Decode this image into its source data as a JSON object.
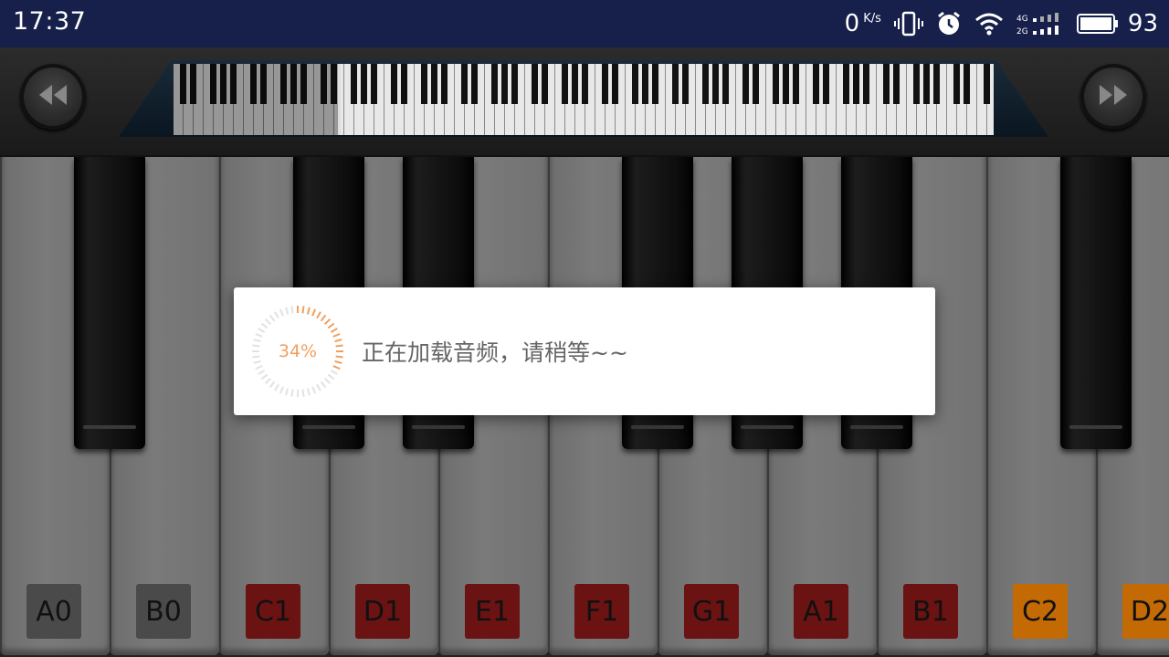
{
  "status_bar": {
    "time": "17:37",
    "net_speed_value": "0",
    "net_speed_unit": "K/s",
    "battery_level": "93",
    "icons": [
      "vibrate-icon",
      "alarm-icon",
      "wifi-icon",
      "signal-4g-2g-icon",
      "battery-icon"
    ]
  },
  "toolbar": {
    "rewind_icon": "rewind-icon",
    "forward_icon": "fast-forward-icon"
  },
  "piano": {
    "white_keys": [
      {
        "label": "A0",
        "color": "#4a4a4a"
      },
      {
        "label": "B0",
        "color": "#4a4a4a"
      },
      {
        "label": "C1",
        "color": "#6b1212"
      },
      {
        "label": "D1",
        "color": "#6b1212"
      },
      {
        "label": "E1",
        "color": "#6b1212"
      },
      {
        "label": "F1",
        "color": "#6b1212"
      },
      {
        "label": "G1",
        "color": "#6b1212"
      },
      {
        "label": "A1",
        "color": "#6b1212"
      },
      {
        "label": "B1",
        "color": "#6b1212"
      },
      {
        "label": "C2",
        "color": "#c46a05"
      },
      {
        "label": "D2",
        "color": "#c46a05"
      }
    ]
  },
  "loading_dialog": {
    "progress_percent": 34,
    "progress_text": "34%",
    "message": "正在加载音频，请稍等~~",
    "accent_color": "#f0a060"
  }
}
